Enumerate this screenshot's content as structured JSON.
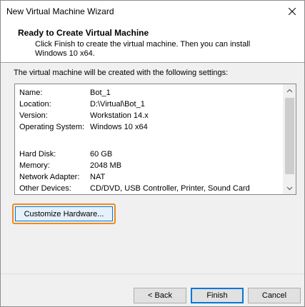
{
  "window": {
    "title": "New Virtual Machine Wizard"
  },
  "header": {
    "title": "Ready to Create Virtual Machine",
    "description": "Click Finish to create the virtual machine. Then you can install Windows 10 x64."
  },
  "intro": "The virtual machine will be created with the following settings:",
  "settings": [
    {
      "label": "Name:",
      "value": "Bot_1"
    },
    {
      "label": "Location:",
      "value": "D:\\Virtual\\Bot_1"
    },
    {
      "label": "Version:",
      "value": "Workstation 14.x"
    },
    {
      "label": "Operating System:",
      "value": "Windows 10 x64"
    },
    {
      "label": "",
      "value": ""
    },
    {
      "label": "Hard Disk:",
      "value": "60 GB"
    },
    {
      "label": "Memory:",
      "value": "2048 MB"
    },
    {
      "label": "Network Adapter:",
      "value": "NAT"
    },
    {
      "label": "Other Devices:",
      "value": "CD/DVD, USB Controller, Printer, Sound Card"
    }
  ],
  "buttons": {
    "customize": "Customize Hardware...",
    "back": "< Back",
    "finish": "Finish",
    "cancel": "Cancel"
  },
  "icons": {
    "close": "close-icon",
    "scroll_up": "chevron-up-icon",
    "scroll_down": "chevron-down-icon"
  },
  "colors": {
    "highlight_outline": "#f08a1c",
    "focus_blue": "#0078d7"
  }
}
